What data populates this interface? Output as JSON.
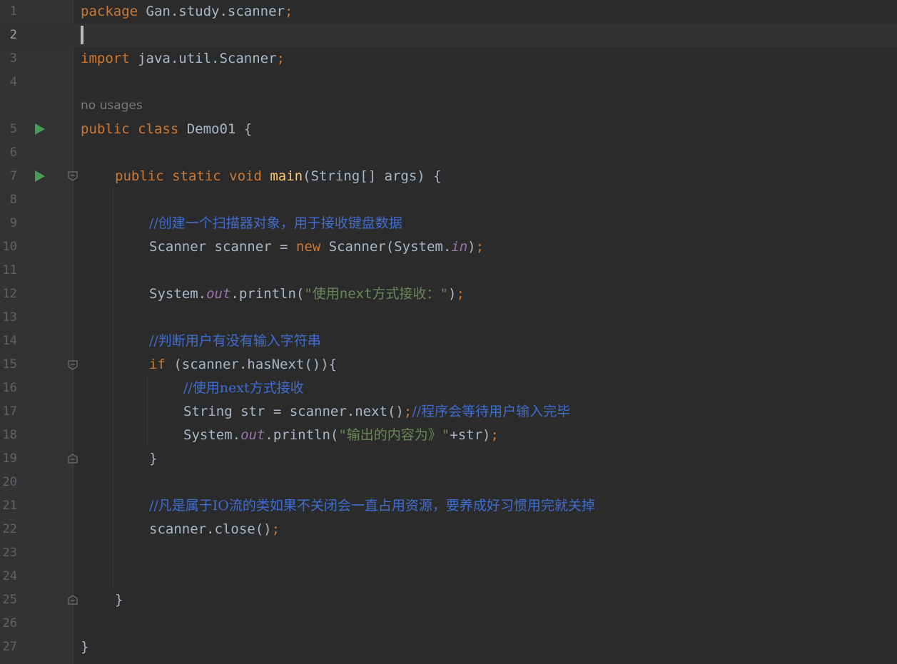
{
  "editor": {
    "line_numbers": [
      "1",
      "2",
      "3",
      "4",
      "5",
      "6",
      "7",
      "8",
      "9",
      "10",
      "11",
      "12",
      "13",
      "14",
      "15",
      "16",
      "17",
      "18",
      "19",
      "20",
      "21",
      "22",
      "23",
      "24",
      "25",
      "26",
      "27"
    ],
    "current_line": "2",
    "usage_hint": "no usages",
    "code": {
      "l1_kw": "package",
      "l1_rest": " Gan.study.scanner",
      "l1_semi": ";",
      "l3_kw": "import",
      "l3_rest": " java.util.Scanner",
      "l3_semi": ";",
      "l5_kw": "public class",
      "l5_rest": " Demo01 {",
      "l7_kw": "public static void",
      "l7_fn": "main",
      "l7_rest": "(String[] args) {",
      "l9_comment": "//创建一个扫描器对象，用于接收键盘数据",
      "l10_a": "Scanner scanner = ",
      "l10_kw": "new",
      "l10_b": " Scanner(System.",
      "l10_field": "in",
      "l10_c": ")",
      "l10_semi": ";",
      "l12_a": "System.",
      "l12_field": "out",
      "l12_b": ".println(",
      "l12_str": "\"使用next方式接收：\"",
      "l12_c": ")",
      "l12_semi": ";",
      "l14_comment": "//判断用户有没有输入字符串",
      "l15_kw": "if",
      "l15_rest": " (scanner.hasNext()){",
      "l16_comment": "//使用next方式接收",
      "l17_a": "String str = scanner.next()",
      "l17_semi": ";",
      "l17_comment": "//程序会等待用户输入完毕",
      "l18_a": "System.",
      "l18_field": "out",
      "l18_b": ".println(",
      "l18_str": "\"输出的内容为》\"",
      "l18_c": "+str)",
      "l18_semi": ";",
      "l19": "}",
      "l21_comment": "//凡是属于IO流的类如果不关闭会一直占用资源，要养成好习惯用完就关掉",
      "l22_a": "scanner.close()",
      "l22_semi": ";",
      "l25": "}",
      "l27": "}"
    }
  },
  "colors": {
    "background": "#2b2b2b",
    "keyword": "#cc7832",
    "function": "#ffc66d",
    "string": "#6a8759",
    "comment": "#3f6ccf",
    "field": "#9876aa",
    "run_icon": "#499c54"
  }
}
